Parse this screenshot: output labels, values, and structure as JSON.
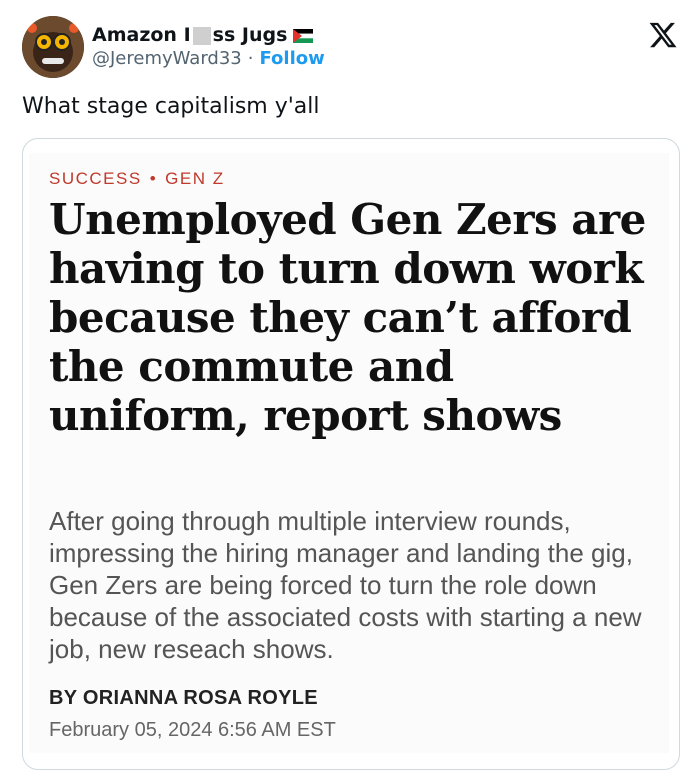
{
  "author": {
    "name_part1": "Amazon I",
    "name_part2": "ss Jugs",
    "handle": "@JeremyWard33",
    "separator": "·",
    "follow_label": "Follow",
    "flag_icon": "palestine-flag-icon"
  },
  "tweet": {
    "text": "What stage capitalism y'all"
  },
  "article": {
    "kicker_section": "SUCCESS",
    "kicker_sep": "•",
    "kicker_topic": "GEN Z",
    "kicker_color": "#c0392b",
    "headline": "Unemployed Gen Zers are having to turn down work because they can’t afford the commute and uniform, report shows",
    "deck": "After going through multiple interview rounds, impressing the hiring manager and landing the gig, Gen Zers are being forced to turn the role down because of the associated costs with starting a new job, new reseach shows.",
    "byline": "BY ORIANNA ROSA ROYLE",
    "date": "February 05, 2024 6:56 AM EST"
  },
  "colors": {
    "accent": "#1d9bf0",
    "text": "#0f1419",
    "muted": "#536471"
  }
}
